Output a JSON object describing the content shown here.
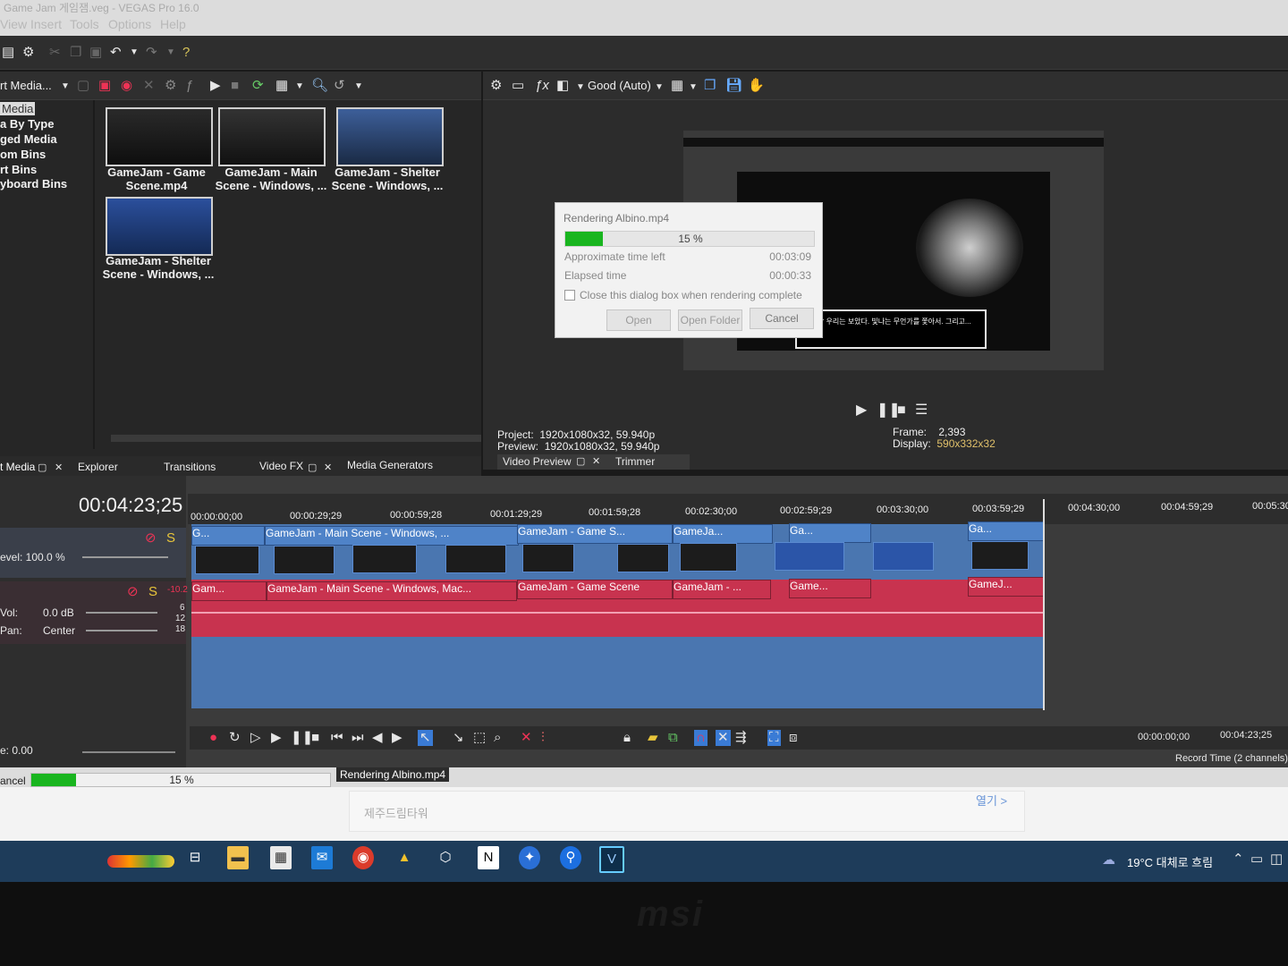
{
  "window": {
    "title": "Game Jam 게임잼.veg - VEGAS Pro 16.0"
  },
  "menu": [
    "View",
    "Insert",
    "Tools",
    "Options",
    "Help"
  ],
  "media_tree": [
    "Media",
    "a By Type",
    "ged Media",
    "om Bins",
    "rt Bins",
    "yboard Bins"
  ],
  "media_toolbar": {
    "dropdown": "rt Media..."
  },
  "media_items": [
    {
      "line1": "GameJam - Game",
      "line2": "Scene.mp4"
    },
    {
      "line1": "GameJam - Main",
      "line2": "Scene - Windows, ..."
    },
    {
      "line1": "GameJam - Shelter",
      "line2": "Scene - Windows, ..."
    },
    {
      "line1": "GameJam - Shelter",
      "line2": "Scene - Windows, ..."
    }
  ],
  "left_tabs": [
    "t Media",
    "Explorer",
    "Transitions",
    "Video FX",
    "Media Generators"
  ],
  "preview": {
    "quality": "Good (Auto)",
    "project_label": "Project:",
    "project_value": "1920x1080x32, 59.940p",
    "preview_label": "Preview:",
    "preview_value": "1920x1080x32, 59.940p",
    "frame_label": "Frame:",
    "frame_value": "2,393",
    "display_label": "Display:",
    "display_value": "590x332x32",
    "tabs": [
      "Video Preview",
      "Trimmer"
    ],
    "dialogue_text": "그날 밤 우리는 보았다. 빛나는 무언가를 쫓아서. 그리고..."
  },
  "render_dialog": {
    "title": "Rendering Albino.mp4",
    "progress_percent": 15,
    "progress_text": "15 %",
    "time_left_label": "Approximate time left",
    "time_left_value": "00:03:09",
    "elapsed_label": "Elapsed time",
    "elapsed_value": "00:00:33",
    "checkbox_label": "Close this dialog box when rendering complete",
    "btn_open": "Open",
    "btn_open_folder": "Open Folder",
    "btn_cancel": "Cancel"
  },
  "timeline": {
    "timecode": "00:04:23;25",
    "ruler": [
      "00:00:00;00",
      "00:00:29;29",
      "00:00:59;28",
      "00:01:29;29",
      "00:01:59;28",
      "00:02:30;00",
      "00:02:59;29",
      "00:03:30;00",
      "00:03:59;29",
      "00:04:30;00",
      "00:04:59;29",
      "00:05:30"
    ],
    "video_track": {
      "level": "evel: 100.0 %"
    },
    "audio_track": {
      "vol_label": "Vol:",
      "vol_value": "0.0 dB",
      "pan_label": "Pan:",
      "pan_value": "Center",
      "meter_top": "-10.2",
      "meter_marks": [
        "6",
        "12",
        "18"
      ]
    },
    "video_clips": [
      "G...",
      "GameJam - Main Scene - Windows, ...",
      "GameJam - Game S...",
      "GameJa...",
      "Ga...",
      "Ga..."
    ],
    "audio_clips": [
      "Gam...",
      "GameJam - Main Scene - Windows, Mac...",
      "GameJam - Game Scene",
      "GameJam - ...",
      "Game...",
      "GameJ..."
    ],
    "rate": "e: 0.00",
    "cursor_time": "00:00:00;00",
    "end_time": "00:04:23;25",
    "record_time": "Record Time (2 channels)"
  },
  "status": {
    "cancel": "ancel",
    "progress_text": "15 %",
    "progress_percent": 15,
    "rendering": "Rendering Albino.mp4"
  },
  "notification": {
    "location": "제주드림타워",
    "open": "열기 >"
  },
  "taskbar": {
    "weather": "19°C 대체로 흐림"
  },
  "monitor_brand": "msi"
}
